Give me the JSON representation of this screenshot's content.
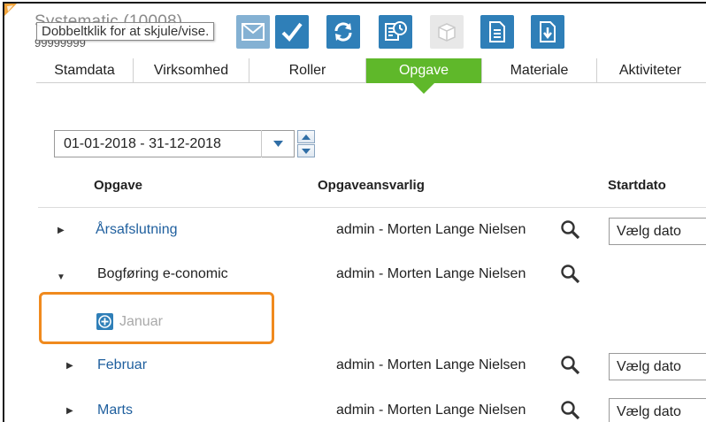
{
  "header": {
    "title": "Systematic (10008)",
    "customer_number": "99999999",
    "tooltip": "Dobbeltklik for at skjule/vise."
  },
  "toolbar": {
    "buttons": [
      {
        "icon": "email-icon"
      },
      {
        "icon": "checkmark-icon"
      },
      {
        "icon": "refresh-icon"
      },
      {
        "icon": "task-clock-icon"
      },
      {
        "icon": "box-icon"
      },
      {
        "icon": "document-icon"
      },
      {
        "icon": "download-icon"
      }
    ]
  },
  "tabs": [
    {
      "label": "Stamdata"
    },
    {
      "label": "Virksomhed"
    },
    {
      "label": "Roller"
    },
    {
      "label": "Opgave",
      "active": true
    },
    {
      "label": "Materiale"
    },
    {
      "label": "Aktiviteter"
    }
  ],
  "filter": {
    "period": "01-01-2018 - 31-12-2018"
  },
  "columns": {
    "task": "Opgave",
    "owner": "Opgaveansvarlig",
    "start": "Startdato"
  },
  "rows": [
    {
      "name": "Årsafslutning",
      "owner": "admin - Morten Lange Nielsen",
      "date": "Vælg dato",
      "expanded": false
    },
    {
      "name": "Bogføring e-conomic",
      "owner": "admin - Morten Lange Nielsen",
      "expanded": true
    },
    {
      "name": "Januar",
      "subtask": true
    },
    {
      "name": "Februar",
      "owner": "admin - Morten Lange Nielsen",
      "date": "Vælg dato",
      "expanded": false
    },
    {
      "name": "Marts",
      "owner": "admin - Morten Lange Nielsen",
      "date": "Vælg dato",
      "expanded": false
    }
  ],
  "colors": {
    "accent_green": "#5fb82a",
    "toolbar_blue": "#2f7fb8",
    "link_blue": "#1f5f9e",
    "highlight_orange": "#f08a1e"
  }
}
